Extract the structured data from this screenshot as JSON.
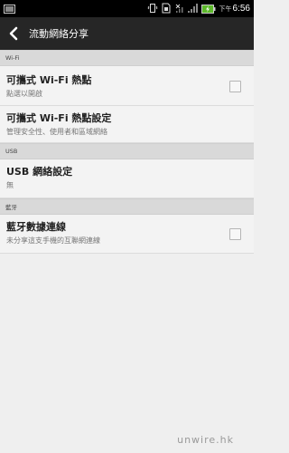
{
  "status_bar": {
    "ampm": "下午",
    "time": "6:56",
    "icons": [
      "gallery-icon",
      "vibrate-icon",
      "sim-icon",
      "signal-off-icon",
      "signal-bars-icon",
      "battery-charging-icon"
    ]
  },
  "action_bar": {
    "title": "流動網絡分享",
    "back_icon": "chevron-left-icon"
  },
  "sections": {
    "wifi": {
      "header": "Wi-Fi",
      "items": [
        {
          "title": "可攜式 Wi-Fi 熱點",
          "subtitle": "點選以開啟",
          "control": "checkbox",
          "checked": false
        },
        {
          "title": "可攜式 Wi-Fi 熱點設定",
          "subtitle": "管理安全性、使用者和區域網絡"
        }
      ]
    },
    "usb": {
      "header": "USB",
      "items": [
        {
          "title": "USB 網絡設定",
          "subtitle": "無"
        }
      ]
    },
    "bluetooth": {
      "header": "藍牙",
      "items": [
        {
          "title": "藍牙數據連線",
          "subtitle": "未分享這支手機的互聯網連線",
          "control": "checkbox",
          "checked": false
        }
      ]
    }
  },
  "watermark": "unwire.hk",
  "colors": {
    "status_bar_bg": "#000000",
    "action_bar_bg": "#262626",
    "section_header_bg": "#d9d9d9",
    "list_bg": "#f3f3f3",
    "page_bg": "#efefef"
  }
}
